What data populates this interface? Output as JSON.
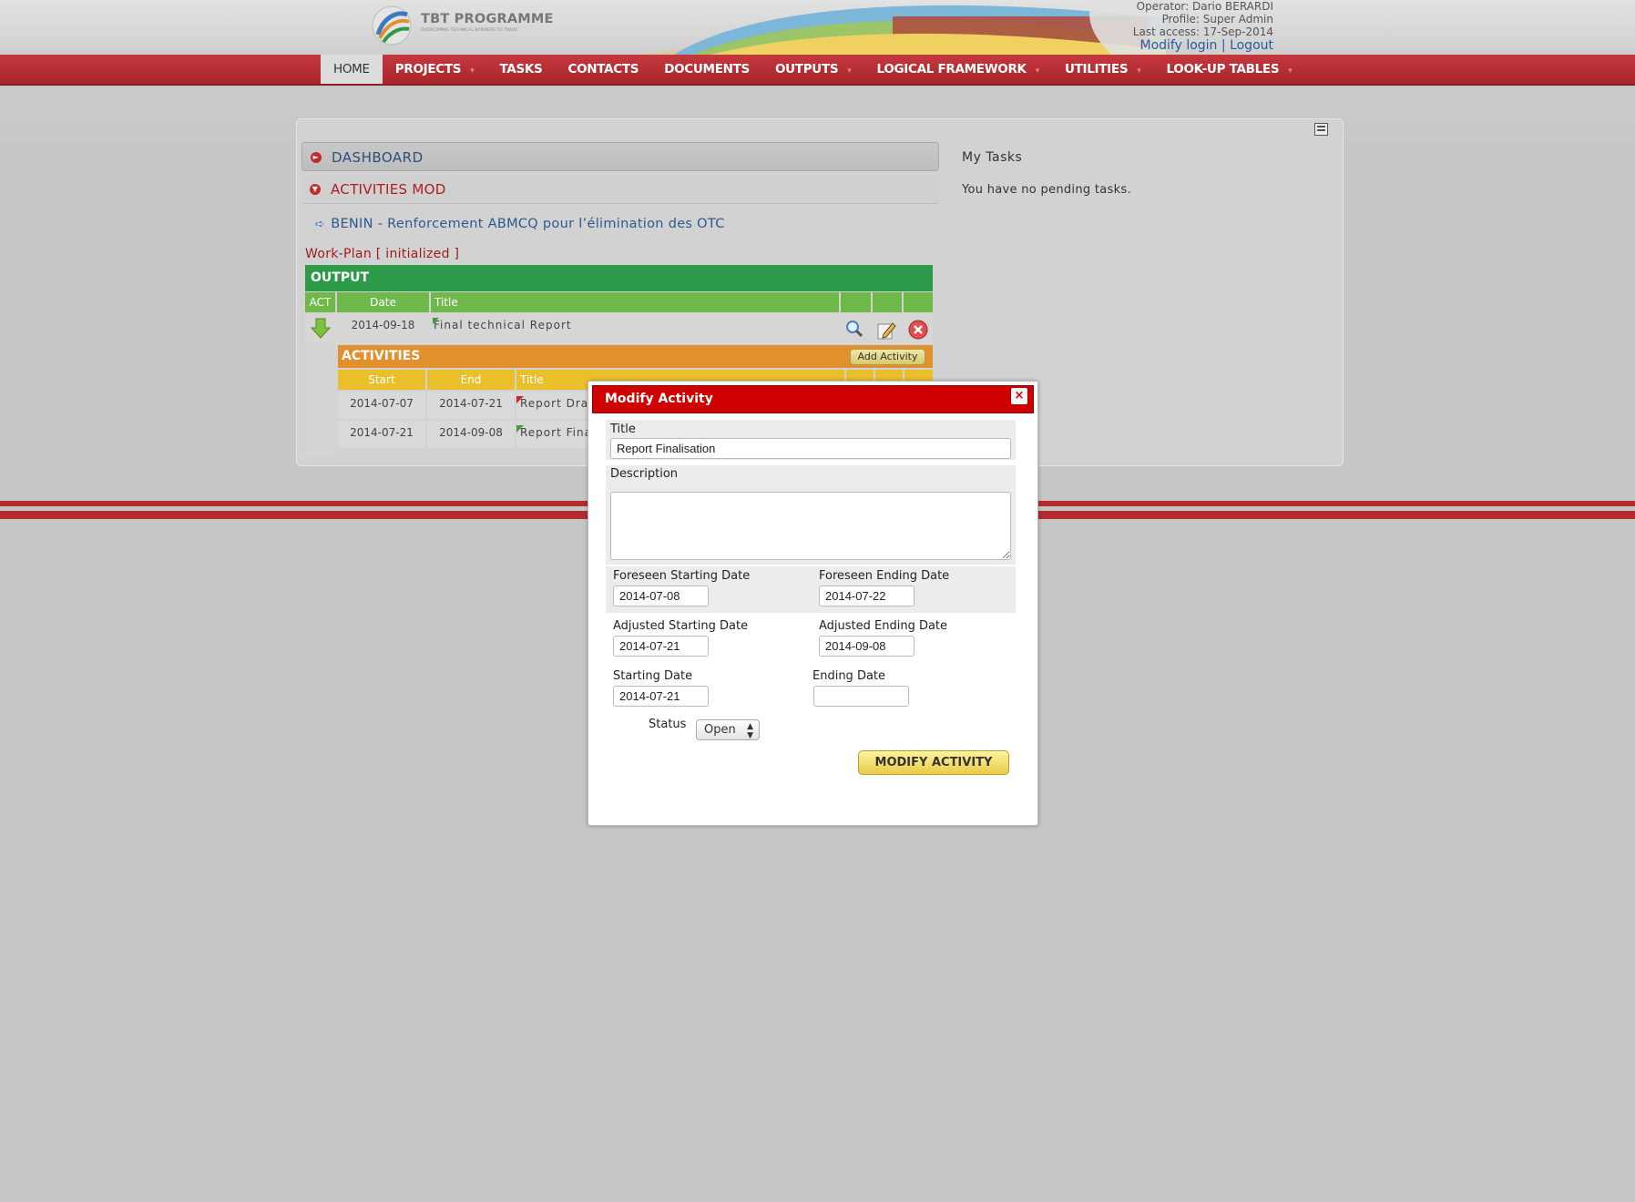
{
  "header": {
    "logo_text": "TBT PROGRAMME",
    "logo_tagline": "OVERCOMING TECHNICAL BARRIERS TO TRADE",
    "operator": "Operator: Dario BERARDI",
    "profile": "Profile: Super Admin",
    "last_access": "Last access: 17-Sep-2014",
    "modify_login": "Modify login",
    "separator": "|",
    "logout": "Logout"
  },
  "nav": {
    "items": [
      {
        "label": "HOME",
        "caret": false
      },
      {
        "label": "PROJECTS",
        "caret": true
      },
      {
        "label": "TASKS",
        "caret": false
      },
      {
        "label": "CONTACTS",
        "caret": false
      },
      {
        "label": "DOCUMENTS",
        "caret": false
      },
      {
        "label": "OUTPUTS",
        "caret": true
      },
      {
        "label": "LOGICAL FRAMEWORK",
        "caret": true
      },
      {
        "label": "UTILITIES",
        "caret": true
      },
      {
        "label": "LOOK-UP TABLES",
        "caret": true
      }
    ],
    "caret_glyph": "▾"
  },
  "left": {
    "dashboard": "DASHBOARD",
    "activities_mod": "ACTIVITIES MOD",
    "project_link": "BENIN - Renforcement ABMCQ pour l’élimination des OTC",
    "workplan": "Work-Plan [ initialized ]"
  },
  "output_table": {
    "title": "OUTPUT",
    "headers": {
      "act": "ACT",
      "date": "Date",
      "title": "Title"
    },
    "row": {
      "date": "2014-09-18",
      "title": "Final technical Report"
    }
  },
  "activities_table": {
    "title": "ACTIVITIES",
    "add_button": "Add Activity",
    "headers": {
      "start": "Start",
      "end": "End",
      "title": "Title"
    },
    "rows": [
      {
        "start": "2014-07-07",
        "end": "2014-07-21",
        "title": "Report Draf"
      },
      {
        "start": "2014-07-21",
        "end": "2014-09-08",
        "title": "Report Fina"
      }
    ]
  },
  "right": {
    "my_tasks": "My Tasks",
    "no_tasks": "You have no pending tasks."
  },
  "modal": {
    "title": "Modify Activity",
    "close": "×",
    "title_label": "Title",
    "title_value": "Report Finalisation",
    "description_label": "Description",
    "description_value": "",
    "foreseen_start_label": "Foreseen Starting Date",
    "foreseen_start_value": "2014-07-08",
    "foreseen_end_label": "Foreseen Ending Date",
    "foreseen_end_value": "2014-07-22",
    "adjusted_start_label": "Adjusted Starting Date",
    "adjusted_start_value": "2014-07-21",
    "adjusted_end_label": "Adjusted Ending Date",
    "adjusted_end_value": "2014-09-08",
    "start_label": "Starting Date",
    "start_value": "2014-07-21",
    "end_label": "Ending Date",
    "end_value": "",
    "status_label": "Status",
    "status_value": "Open",
    "status_arrows": "▲▼",
    "submit": "MODIFY ACTIVITY"
  },
  "colors": {
    "nav_red": "#b42a2f",
    "output_green": "#2d9a49",
    "activities_orange": "#e1902d",
    "modal_red": "#d10000"
  }
}
